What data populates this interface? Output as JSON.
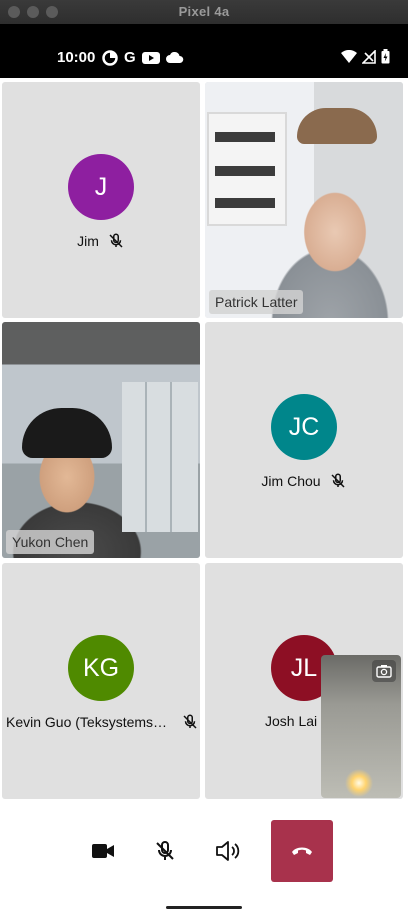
{
  "window": {
    "title": "Pixel 4a"
  },
  "status_bar": {
    "time": "10:00",
    "google_letter": "G"
  },
  "participants": [
    {
      "name": "Jim",
      "initials": "J",
      "avatar_color": "#8e1fa0",
      "muted": true,
      "video": false
    },
    {
      "name": "Patrick Latter",
      "muted": false,
      "video": true
    },
    {
      "name": "Yukon Chen",
      "muted": false,
      "video": true
    },
    {
      "name": "Jim Chou",
      "initials": "JC",
      "avatar_color": "#00868b",
      "muted": true,
      "video": false
    },
    {
      "name": "Kevin Guo (Teksystems…",
      "initials": "KG",
      "avatar_color": "#4f8a00",
      "muted": true,
      "video": false
    },
    {
      "name": "Josh Lai",
      "initials": "JL",
      "avatar_color": "#8d0f24",
      "muted": false,
      "video": false
    }
  ],
  "self_view": {
    "icon": "camera-switch-icon"
  },
  "controls": {
    "camera_icon": "video-camera-icon",
    "mic_icon": "mic-off-icon",
    "speaker_icon": "speaker-icon",
    "end_call_icon": "hang-up-icon",
    "end_call_color": "#a8324c"
  }
}
